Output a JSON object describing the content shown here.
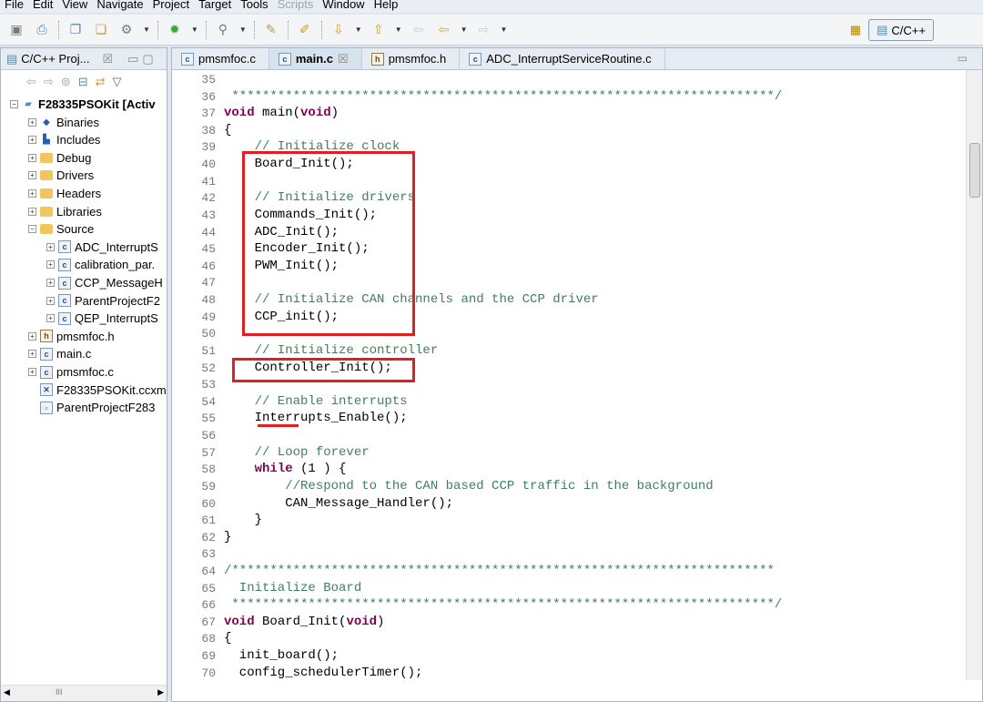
{
  "menu": [
    "File",
    "Edit",
    "View",
    "Navigate",
    "Project",
    "Target",
    "Tools",
    "Scripts",
    "Window",
    "Help"
  ],
  "perspective": {
    "label": "C/C++"
  },
  "left_panel": {
    "tab_label": "C/C++ Proj...",
    "tree": [
      {
        "label": "F28335PSOKit  [Activ",
        "icon": "project",
        "depth": 0,
        "exp": "-"
      },
      {
        "label": "Binaries",
        "icon": "binaries",
        "depth": 1,
        "exp": "+"
      },
      {
        "label": "Includes",
        "icon": "includes",
        "depth": 1,
        "exp": "+"
      },
      {
        "label": "Debug",
        "icon": "folder",
        "depth": 1,
        "exp": "+"
      },
      {
        "label": "Drivers",
        "icon": "folder",
        "depth": 1,
        "exp": "+"
      },
      {
        "label": "Headers",
        "icon": "folder",
        "depth": 1,
        "exp": "+"
      },
      {
        "label": "Libraries",
        "icon": "folder",
        "depth": 1,
        "exp": "+"
      },
      {
        "label": "Source",
        "icon": "folder",
        "depth": 1,
        "exp": "-"
      },
      {
        "label": "ADC_InterruptS",
        "icon": "c",
        "depth": 2,
        "exp": "+"
      },
      {
        "label": "calibration_par.",
        "icon": "c",
        "depth": 2,
        "exp": "+"
      },
      {
        "label": "CCP_MessageH",
        "icon": "c",
        "depth": 2,
        "exp": "+"
      },
      {
        "label": "ParentProjectF2",
        "icon": "c",
        "depth": 2,
        "exp": "+"
      },
      {
        "label": "QEP_InterruptS",
        "icon": "c",
        "depth": 2,
        "exp": "+"
      },
      {
        "label": "pmsmfoc.h",
        "icon": "h",
        "depth": 1,
        "exp": "+"
      },
      {
        "label": "main.c",
        "icon": "c",
        "depth": 1,
        "exp": "+"
      },
      {
        "label": "pmsmfoc.c",
        "icon": "c",
        "depth": 1,
        "exp": "+"
      },
      {
        "label": "F28335PSOKit.ccxm",
        "icon": "ccxml",
        "depth": 1,
        "exp": ""
      },
      {
        "label": "ParentProjectF283",
        "icon": "file",
        "depth": 1,
        "exp": ""
      }
    ],
    "scroll_glyph": "III"
  },
  "editor": {
    "tabs": [
      {
        "label": "pmsmfoc.c",
        "icon": "c",
        "active": false
      },
      {
        "label": "main.c",
        "icon": "c",
        "active": true
      },
      {
        "label": "pmsmfoc.h",
        "icon": "h",
        "active": false
      },
      {
        "label": "ADC_InterruptServiceRoutine.c",
        "icon": "c",
        "active": false
      }
    ],
    "close_glyph": "☒",
    "first_line": 35,
    "lines": [
      "",
      " ***********************************************************************/",
      "void main(void)",
      "{",
      "    // Initialize clock",
      "    Board_Init();",
      "",
      "    // Initialize drivers",
      "    Commands_Init();",
      "    ADC_Init();",
      "    Encoder_Init();",
      "    PWM_Init();",
      "",
      "    // Initialize CAN channels and the CCP driver",
      "    CCP_init();",
      "",
      "    // Initialize controller",
      "    Controller_Init();",
      "",
      "    // Enable interrupts",
      "    Interrupts_Enable();",
      "",
      "    // Loop forever",
      "    while (1 ) {",
      "        //Respond to the CAN based CCP traffic in the background",
      "        CAN_Message_Handler();",
      "    }",
      "}",
      "",
      "/***********************************************************************",
      "  Initialize Board",
      " ***********************************************************************/",
      "void Board_Init(void)",
      "{",
      "  init_board();",
      "  config_schedulerTimer();"
    ]
  },
  "colors": {
    "comment": "#3f7f5f",
    "keyword": "#7f0055",
    "annotation": "#e02020"
  }
}
